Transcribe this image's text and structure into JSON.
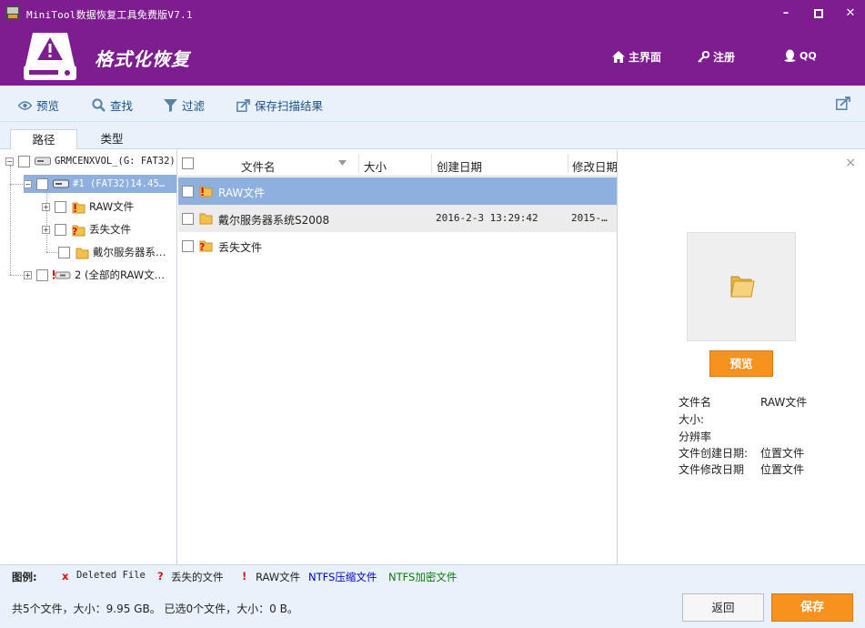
{
  "window": {
    "title": "MiniTool数据恢复工具免费版V7.1",
    "minimize_label": "–",
    "maximize_label": "□",
    "close_label": "✕"
  },
  "banner": {
    "mode_title": "格式化恢复",
    "nav": {
      "home_label": "主界面",
      "register_label": "注册",
      "qq_label": "QQ"
    }
  },
  "toolbar": {
    "preview_label": "预览",
    "find_label": "查找",
    "filter_label": "过滤",
    "save_scan_label": "保存扫描结果"
  },
  "tabs": {
    "path_label": "路径",
    "type_label": "类型"
  },
  "tree": {
    "root_label": "GRMCENXVOL_(G: FAT32)",
    "partition1_label": "#1 (FAT32)14.45…",
    "raw_label": "RAW文件",
    "lost_label": "丢失文件",
    "dell_label": "戴尔服务器系…",
    "partition2_label": "2 (全部的RAW文…"
  },
  "file_list": {
    "headers": {
      "name": "文件名",
      "size": "大小",
      "created": "创建日期",
      "modified": "修改日期"
    },
    "rows": [
      {
        "name": "RAW文件",
        "size": "",
        "created": "",
        "modified": ""
      },
      {
        "name": "戴尔服务器系统S2008",
        "size": "",
        "created": "2016-2-3 13:29:42",
        "modified": "2015-…"
      },
      {
        "name": "丢失文件",
        "size": "",
        "created": "",
        "modified": ""
      }
    ]
  },
  "preview": {
    "button_label": "预览",
    "close_label": "×",
    "info": {
      "filename_label": "文件名",
      "filename_value": "RAW文件",
      "size_label": "大小:",
      "resolution_label": "分辨率",
      "created_label": "文件创建日期:",
      "created_value": "位置文件",
      "modified_label": "文件修改日期",
      "modified_value": "位置文件"
    }
  },
  "legend": {
    "title": "图例:",
    "deleted_mark": "x",
    "deleted_label": "Deleted File",
    "lost_mark": "?",
    "lost_label": "丢失的文件",
    "raw_mark": "!",
    "raw_label": "RAW文件",
    "ntfs_compressed_label": "NTFS压缩文件",
    "ntfs_encrypted_label": "NTFS加密文件"
  },
  "status": {
    "summary": "共5个文件，大小：9.95 GB。 已选0个文件，大小：0 B。",
    "back_label": "返回",
    "save_label": "保存"
  },
  "colors": {
    "brand_purple": "#7d1d8f",
    "accent_orange": "#f7921e",
    "selection_blue": "#8db0df",
    "toolbar_bg": "#e9f2fb",
    "link_blue": "#1b4f8a",
    "ntfs_compressed": "#0000cc",
    "ntfs_encrypted": "#0a7a0a",
    "deleted_red": "#e01010"
  }
}
